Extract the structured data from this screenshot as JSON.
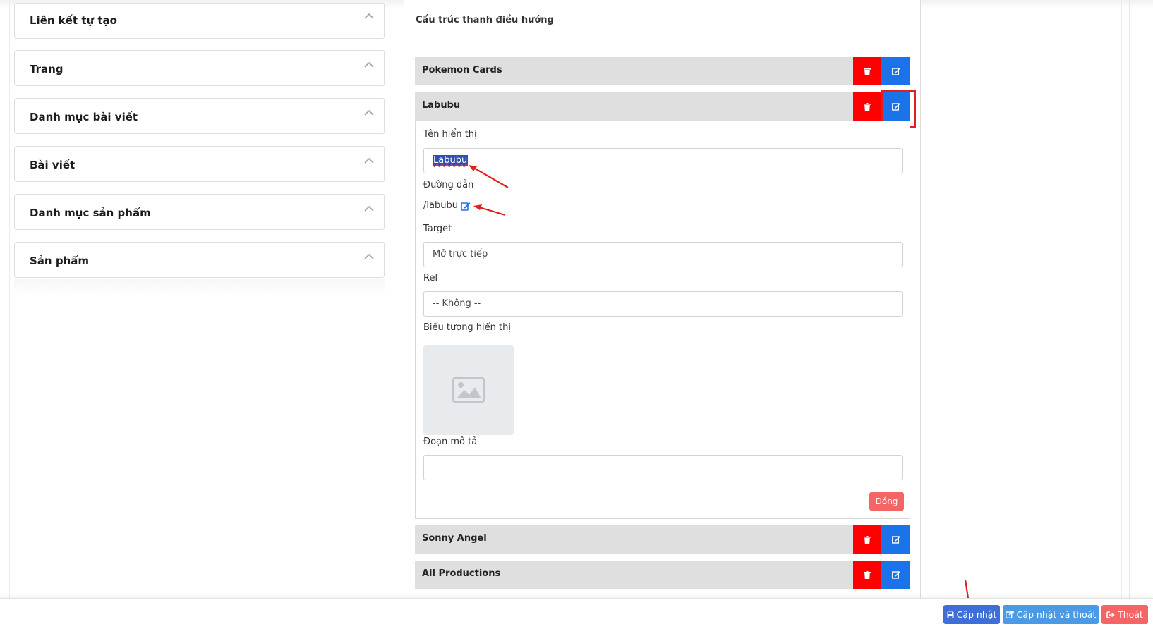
{
  "accordion": {
    "items": [
      {
        "label": "Liên kết tự tạo"
      },
      {
        "label": "Trang"
      },
      {
        "label": "Danh mục bài viết"
      },
      {
        "label": "Bài viết"
      },
      {
        "label": "Danh mục sản phẩm"
      },
      {
        "label": "Sản phẩm"
      }
    ]
  },
  "structure": {
    "title": "Cấu trúc thanh điều hướng",
    "items": [
      {
        "label": "Pokemon Cards"
      },
      {
        "label": "Labubu"
      },
      {
        "label": "Sonny Angel"
      },
      {
        "label": "All Productions"
      }
    ]
  },
  "editor": {
    "display_name_label": "Tên hiển thị",
    "display_name_value": "Labubu",
    "path_label": "Đường dẫn",
    "path_value": "/labubu",
    "target_label": "Target",
    "target_value": "Mở trực tiếp",
    "rel_label": "Rel",
    "rel_value": "-- Không --",
    "icon_label": "Biểu tượng hiển thị",
    "desc_label": "Đoạn mô tả",
    "desc_value": "",
    "close_label": "Đóng"
  },
  "footer": {
    "update_label": "Cập nhật",
    "update_exit_label": "Cập nhật và thoát",
    "exit_label": "Thoát"
  },
  "colors": {
    "delete": "#ff0000",
    "edit": "#1a73e8",
    "annotation": "#e02020"
  }
}
